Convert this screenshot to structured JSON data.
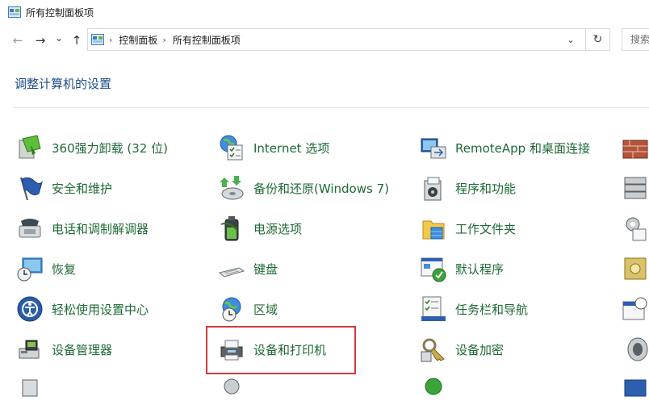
{
  "window": {
    "title": "所有控制面板项"
  },
  "nav": {
    "back_glyph": "←",
    "forward_glyph": "→",
    "recent_glyph": "⌄",
    "up_glyph": "↑"
  },
  "address": {
    "crumbs": [
      "控制面板",
      "所有控制面板项"
    ],
    "separator": "›",
    "dropdown_glyph": "⌄",
    "refresh_glyph": "↻"
  },
  "search": {
    "placeholder": "搜索"
  },
  "heading": "调整计算机的设置",
  "items": [
    {
      "label": "360强力卸载 (32 位)",
      "icon": "uninstall-icon"
    },
    {
      "label": "Internet 选项",
      "icon": "internet-options-icon"
    },
    {
      "label": "RemoteApp 和桌面连接",
      "icon": "remoteapp-icon"
    },
    {
      "label": "安全和维护",
      "icon": "flag-icon"
    },
    {
      "label": "备份和还原(Windows 7)",
      "icon": "backup-icon"
    },
    {
      "label": "程序和功能",
      "icon": "programs-icon"
    },
    {
      "label": "电话和调制解调器",
      "icon": "phone-modem-icon"
    },
    {
      "label": "电源选项",
      "icon": "power-icon"
    },
    {
      "label": "工作文件夹",
      "icon": "work-folders-icon"
    },
    {
      "label": "恢复",
      "icon": "recovery-icon"
    },
    {
      "label": "键盘",
      "icon": "keyboard-icon"
    },
    {
      "label": "默认程序",
      "icon": "default-programs-icon"
    },
    {
      "label": "轻松使用设置中心",
      "icon": "ease-of-access-icon"
    },
    {
      "label": "区域",
      "icon": "region-icon"
    },
    {
      "label": "任务栏和导航",
      "icon": "taskbar-icon"
    },
    {
      "label": "设备管理器",
      "icon": "device-manager-icon"
    },
    {
      "label": "设备和打印机",
      "icon": "printer-icon"
    },
    {
      "label": "设备加密",
      "icon": "device-encryption-icon"
    }
  ],
  "colors": {
    "link_green": "#1e6a35",
    "heading_blue": "#1e4e8c",
    "highlight_red": "#d43b3b"
  }
}
